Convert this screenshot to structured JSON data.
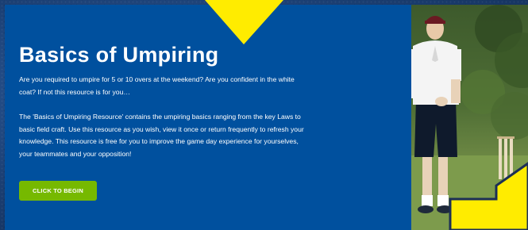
{
  "panel": {
    "title": "Basics of Umpiring",
    "intro": "Are you required to umpire for 5 or 10 overs at the weekend? Are you confident in the white coat? If not this resource is for you…",
    "description": "The 'Basics of Umpiring Resource' contains the umpiring basics ranging from the key Laws to basic field craft. Use this resource as you wish, view it once or return frequently to refresh your knowledge. This resource is free for you to improve the game day experience for yourselves, your teammates and your opposition!",
    "cta_label": "CLICK TO BEGIN"
  },
  "colors": {
    "panel_bg": "#00509e",
    "cta_bg": "#76b900",
    "arrow_fill": "#ffec00"
  },
  "decorations": {
    "arrows": [
      "arrow-down-icon",
      "arrow-right-icon"
    ],
    "photo": "umpire-photo"
  }
}
